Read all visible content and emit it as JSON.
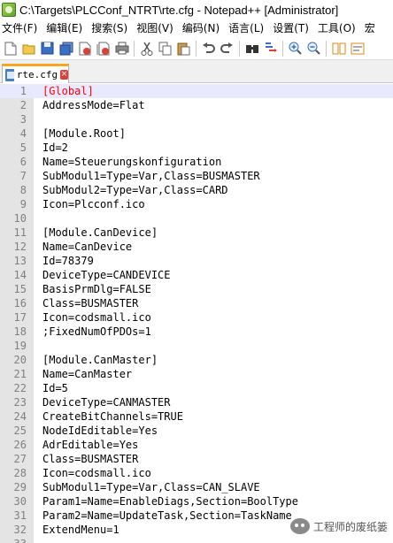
{
  "window": {
    "title": "C:\\Targets\\PLCConf_NTRT\\rte.cfg - Notepad++ [Administrator]"
  },
  "menu": {
    "items": [
      {
        "label": "文件(F)"
      },
      {
        "label": "编辑(E)"
      },
      {
        "label": "搜索(S)"
      },
      {
        "label": "视图(V)"
      },
      {
        "label": "编码(N)"
      },
      {
        "label": "语言(L)"
      },
      {
        "label": "设置(T)"
      },
      {
        "label": "工具(O)"
      },
      {
        "label": "宏"
      }
    ]
  },
  "toolbar": {
    "buttons": [
      {
        "icon": "new-file-icon"
      },
      {
        "icon": "open-file-icon"
      },
      {
        "icon": "save-icon"
      },
      {
        "icon": "save-all-icon"
      },
      {
        "icon": "close-icon"
      },
      {
        "icon": "close-all-icon"
      },
      {
        "icon": "print-icon"
      },
      {
        "icon": "cut-icon"
      },
      {
        "icon": "copy-icon"
      },
      {
        "icon": "paste-icon"
      },
      {
        "icon": "undo-icon"
      },
      {
        "icon": "redo-icon"
      },
      {
        "icon": "find-icon"
      },
      {
        "icon": "replace-icon"
      },
      {
        "icon": "zoom-in-icon"
      },
      {
        "icon": "zoom-out-icon"
      },
      {
        "icon": "sync-scroll-icon"
      },
      {
        "icon": "word-wrap-icon"
      }
    ]
  },
  "tabs": [
    {
      "label": "rte.cfg",
      "active": true
    }
  ],
  "editor": {
    "current_line": 1,
    "lines": [
      {
        "n": "1",
        "text": "[Global]"
      },
      {
        "n": "2",
        "text": "AddressMode=Flat"
      },
      {
        "n": "3",
        "text": ""
      },
      {
        "n": "4",
        "text": "[Module.Root]"
      },
      {
        "n": "5",
        "text": "Id=2"
      },
      {
        "n": "6",
        "text": "Name=Steuerungskonfiguration"
      },
      {
        "n": "7",
        "text": "SubModul1=Type=Var,Class=BUSMASTER"
      },
      {
        "n": "8",
        "text": "SubModul2=Type=Var,Class=CARD"
      },
      {
        "n": "9",
        "text": "Icon=Plcconf.ico"
      },
      {
        "n": "10",
        "text": ""
      },
      {
        "n": "11",
        "text": "[Module.CanDevice]"
      },
      {
        "n": "12",
        "text": "Name=CanDevice"
      },
      {
        "n": "13",
        "text": "Id=78379"
      },
      {
        "n": "14",
        "text": "DeviceType=CANDEVICE"
      },
      {
        "n": "15",
        "text": "BasisPrmDlg=FALSE"
      },
      {
        "n": "16",
        "text": "Class=BUSMASTER"
      },
      {
        "n": "17",
        "text": "Icon=codsmall.ico"
      },
      {
        "n": "18",
        "text": ";FixedNumOfPDOs=1"
      },
      {
        "n": "19",
        "text": ""
      },
      {
        "n": "20",
        "text": "[Module.CanMaster]"
      },
      {
        "n": "21",
        "text": "Name=CanMaster"
      },
      {
        "n": "22",
        "text": "Id=5"
      },
      {
        "n": "23",
        "text": "DeviceType=CANMASTER"
      },
      {
        "n": "24",
        "text": "CreateBitChannels=TRUE"
      },
      {
        "n": "25",
        "text": "NodeIdEditable=Yes"
      },
      {
        "n": "26",
        "text": "AdrEditable=Yes"
      },
      {
        "n": "27",
        "text": "Class=BUSMASTER"
      },
      {
        "n": "28",
        "text": "Icon=codsmall.ico"
      },
      {
        "n": "29",
        "text": "SubModul1=Type=Var,Class=CAN_SLAVE"
      },
      {
        "n": "30",
        "text": "Param1=Name=EnableDiags,Section=BoolType"
      },
      {
        "n": "31",
        "text": "Param2=Name=UpdateTask,Section=TaskName"
      },
      {
        "n": "32",
        "text": "ExtendMenu=1"
      },
      {
        "n": "33",
        "text": ""
      }
    ]
  },
  "watermark": {
    "label": "工程师的废纸篓"
  }
}
